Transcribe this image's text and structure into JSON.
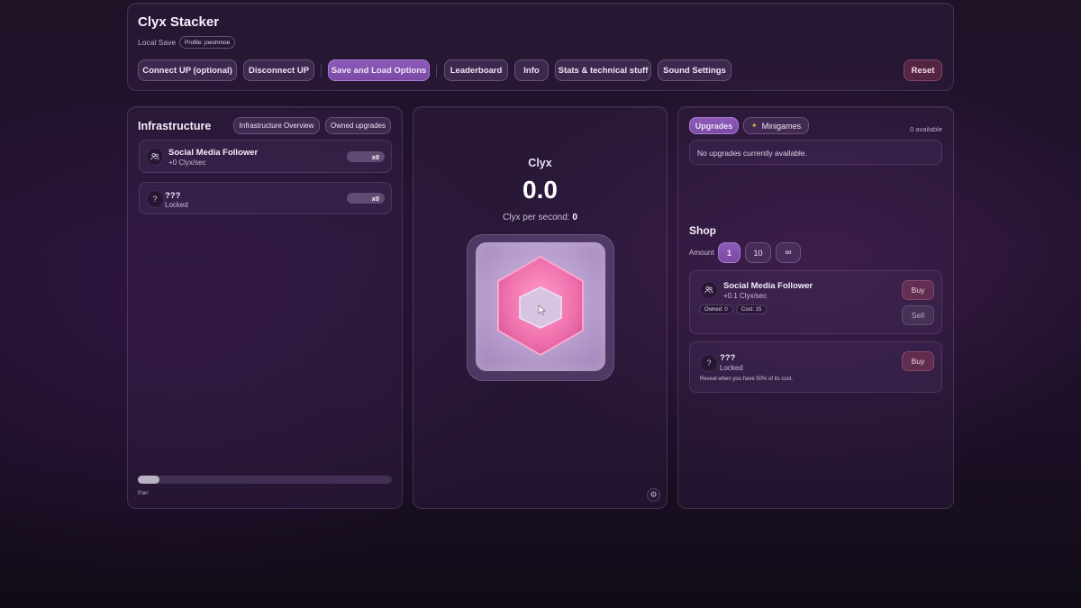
{
  "header": {
    "app_title": "Clyx Stacker",
    "save_label": "Local Save",
    "profile_badge": "Profile: joeshmoe",
    "buttons": {
      "connect": "Connect UP (optional)",
      "disconnect": "Disconnect UP",
      "save_load": "Save and Load Options",
      "leaderboard": "Leaderboard",
      "info": "Info",
      "stats": "Stats & technical stuff",
      "sound": "Sound Settings",
      "reset": "Reset"
    }
  },
  "infrastructure": {
    "title": "Infrastructure",
    "tab_overview": "Infrastructure Overview",
    "tab_owned": "Owned upgrades",
    "items": [
      {
        "name": "Social Media Follower",
        "rate": "+0 Clyx/sec",
        "count": "x0",
        "icon": "users-icon"
      },
      {
        "name": "???",
        "rate": "Locked",
        "count": "x0",
        "icon": "question-icon"
      }
    ],
    "pan_label": "Pan",
    "pan_position": 0.0
  },
  "center": {
    "currency_label": "Clyx",
    "value": "0.0",
    "per_second_label": "Clyx per second:",
    "per_second_value": "0",
    "accent": "#ea6aa6"
  },
  "upgrades": {
    "tab_upgrades": "Upgrades",
    "tab_minigames": "Minigames",
    "available": "0 available",
    "empty_message": "No upgrades currently available."
  },
  "shop": {
    "title": "Shop",
    "amount_label": "Amount",
    "amounts": [
      "1",
      "10",
      "∞"
    ],
    "selected_amount": "1",
    "items": [
      {
        "name": "Social Media Follower",
        "rate": "+0.1 Clyx/sec",
        "owned": "Owned: 0",
        "cost": "Cost: 15",
        "buy": "Buy",
        "sell": "Sell"
      },
      {
        "name": "???",
        "rate": "Locked",
        "hint": "Reveal when you have 50% of its cost.",
        "buy": "Buy"
      }
    ]
  },
  "colors": {
    "accent_purple": "#8d5aba",
    "pink": "#ea6aa6",
    "danger": "#783250"
  }
}
